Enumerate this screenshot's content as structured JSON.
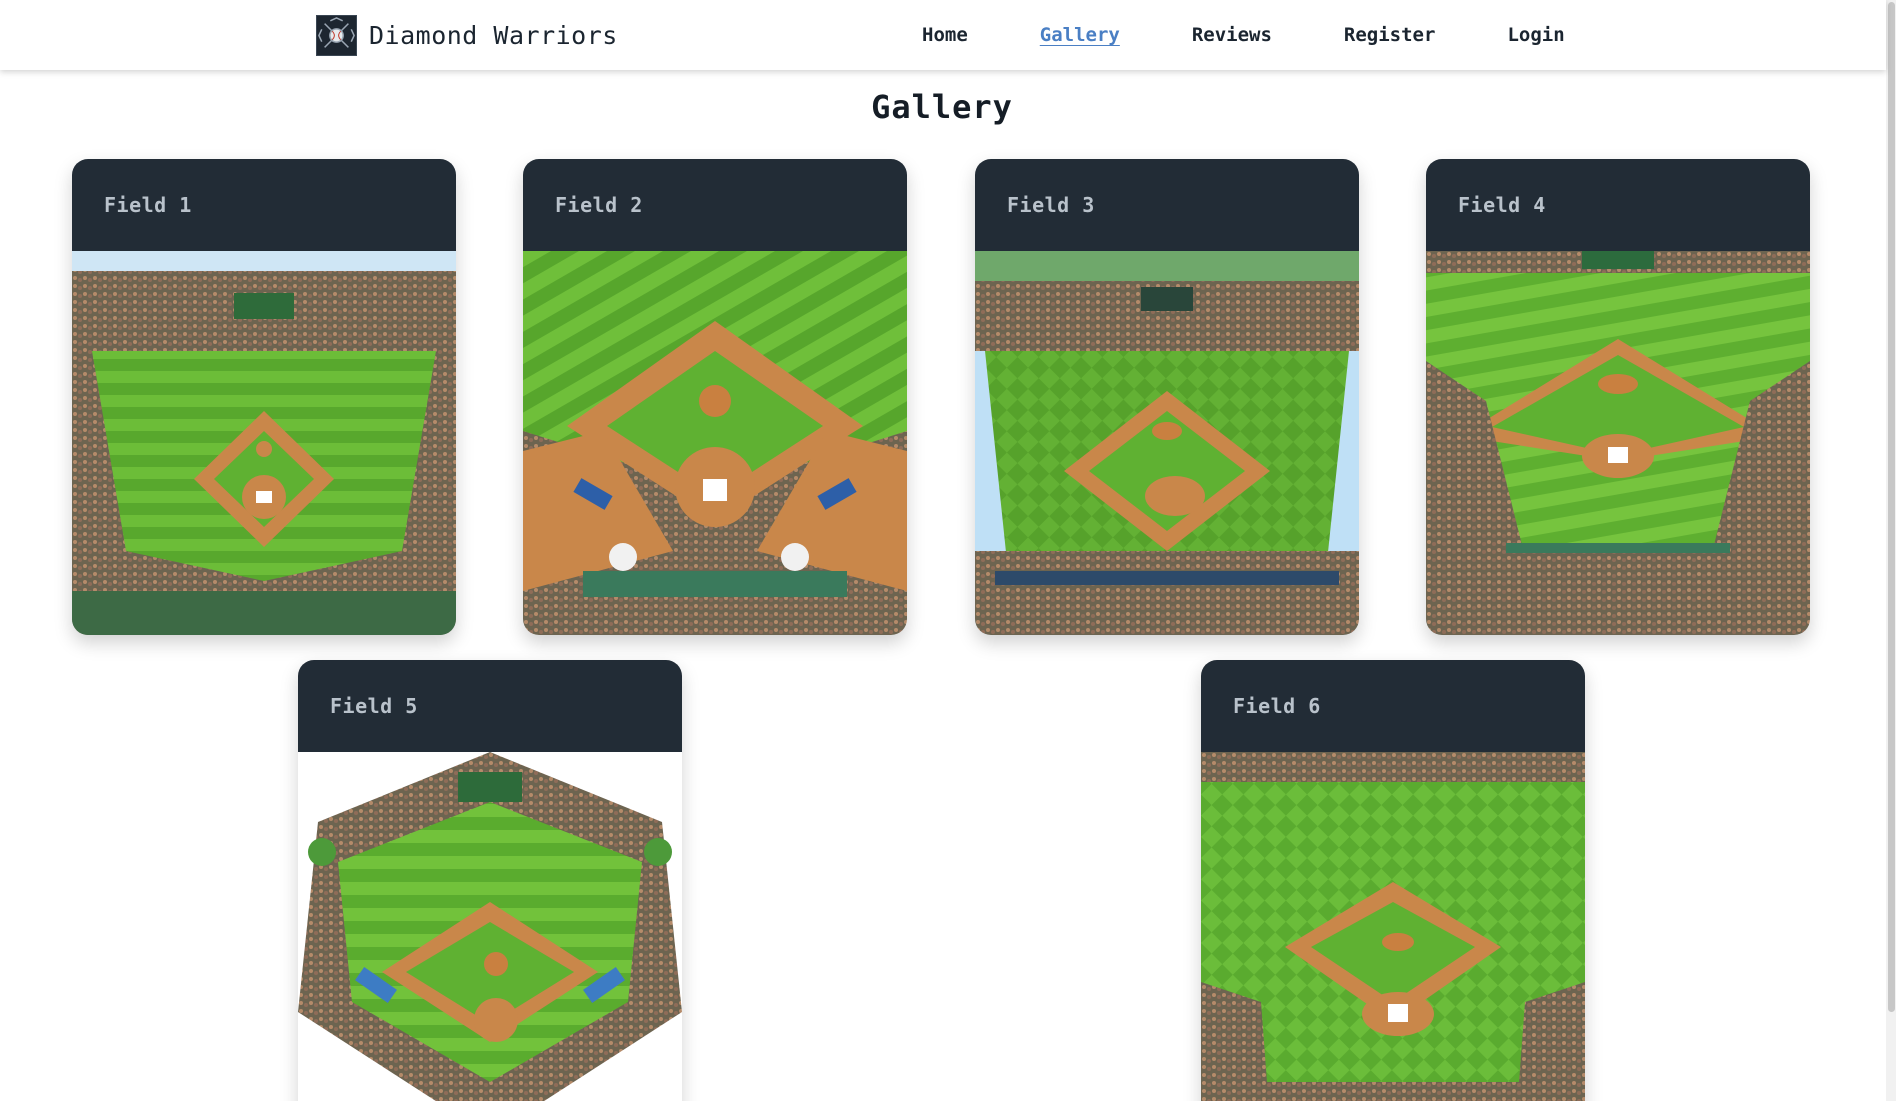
{
  "header": {
    "brand_name": "Diamond Warriors",
    "logo_icon": "baseball-crest-logo",
    "nav": [
      {
        "label": "Home",
        "active": false
      },
      {
        "label": "Gallery",
        "active": true
      },
      {
        "label": "Reviews",
        "active": false
      },
      {
        "label": "Register",
        "active": false
      },
      {
        "label": "Login",
        "active": false
      }
    ]
  },
  "page": {
    "title": "Gallery"
  },
  "cards": [
    {
      "title": "Field 1"
    },
    {
      "title": "Field 2"
    },
    {
      "title": "Field 3"
    },
    {
      "title": "Field 4"
    },
    {
      "title": "Field 5"
    },
    {
      "title": "Field 6"
    }
  ],
  "colors": {
    "header_bg": "#ffffff",
    "card_header_bg": "#222c36",
    "card_title": "#b9c2cb",
    "nav_active": "#4a7fc4",
    "grass_light": "#6fbf3a",
    "grass_dark": "#4f9a2a",
    "infield_dirt": "#c9874a",
    "crowd": "#7a5c48"
  }
}
